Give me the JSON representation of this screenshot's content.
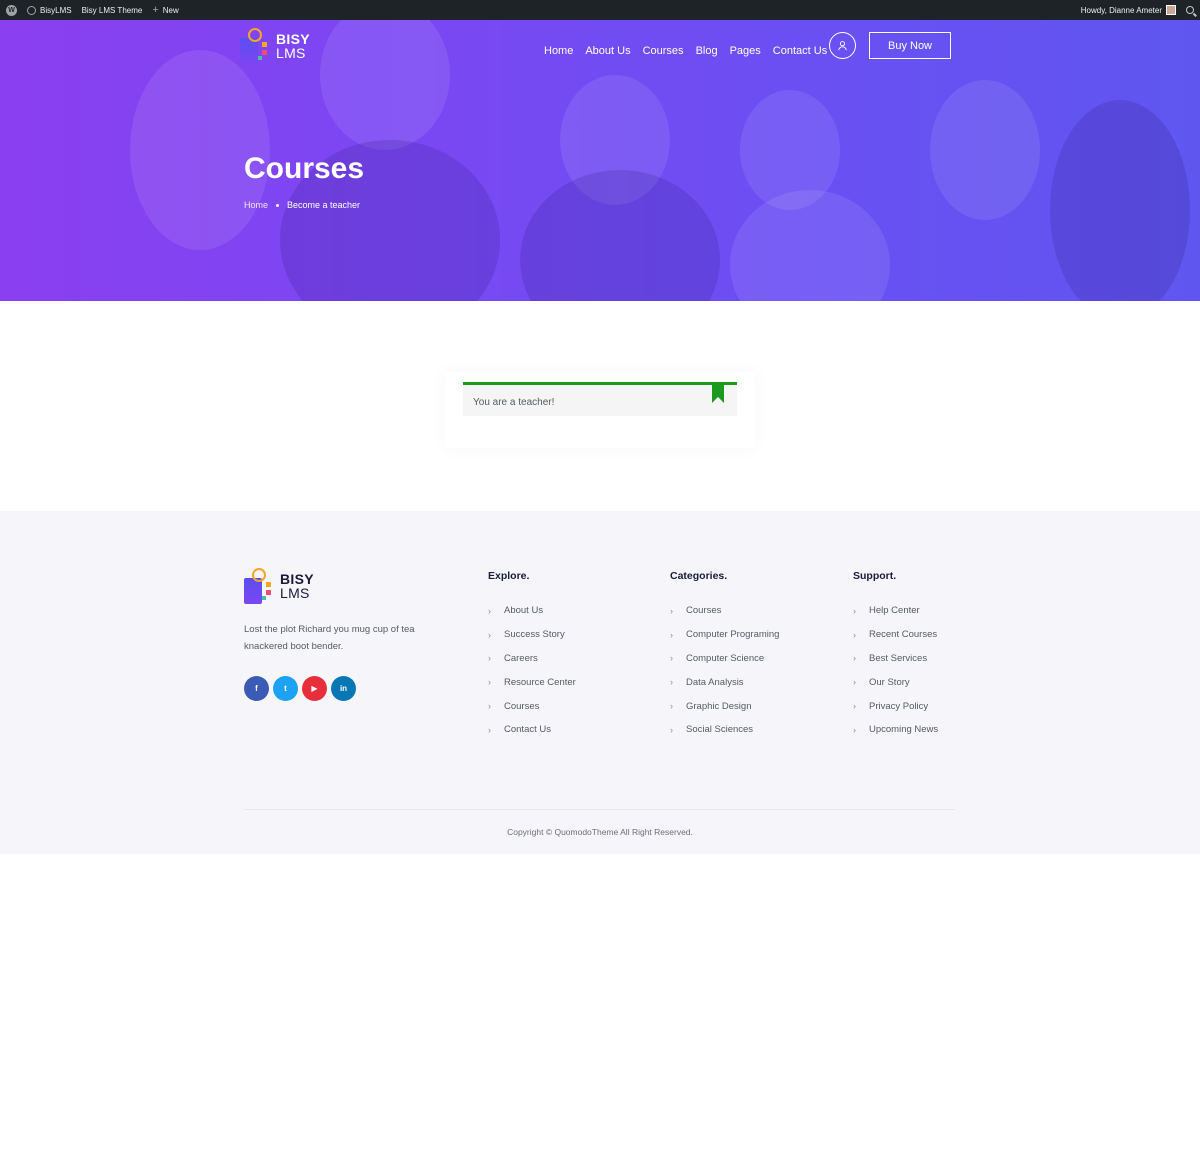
{
  "adminbar": {
    "site_name": "BisyLMS",
    "theme_name": "Bisy LMS Theme",
    "new_label": "New",
    "howdy": "Howdy, Dianne Ameter"
  },
  "brand": {
    "bold": "BISY",
    "light": "LMS"
  },
  "nav": {
    "items": [
      "Home",
      "About Us",
      "Courses",
      "Blog",
      "Pages",
      "Contact Us"
    ],
    "buy_label": "Buy Now"
  },
  "hero": {
    "title": "Courses",
    "breadcrumb_home": "Home",
    "breadcrumb_current": "Become a teacher"
  },
  "notice": {
    "message": "You are a teacher!"
  },
  "footer": {
    "description": "Lost the plot Richard you mug cup of tea knackered boot bender.",
    "socials": [
      {
        "icon": "facebook-icon",
        "glyph": "f",
        "color": "#3b5bb5"
      },
      {
        "icon": "twitter-icon",
        "glyph": "t",
        "color": "#1da1f2"
      },
      {
        "icon": "youtube-icon",
        "glyph": "▶",
        "color": "#e62f3b"
      },
      {
        "icon": "linkedin-icon",
        "glyph": "in",
        "color": "#0a77b5"
      }
    ],
    "columns": [
      {
        "title": "Explore.",
        "items": [
          "About Us",
          "Success Story",
          "Careers",
          "Resource Center",
          "Courses",
          "Contact Us"
        ]
      },
      {
        "title": "Categories.",
        "items": [
          "Courses",
          "Computer Programing",
          "Computer Science",
          "Data Analysis",
          "Graphic Design",
          "Social Sciences"
        ]
      },
      {
        "title": "Support.",
        "items": [
          "Help Center",
          "Recent Courses",
          "Best Services",
          "Our Story",
          "Privacy Policy",
          "Upcoming News"
        ]
      }
    ],
    "copyright": "Copyright © QuomodoTheme All Right Reserved."
  },
  "colors": {
    "accent": "#7a48f3",
    "success": "#1c9a1f",
    "footer_bg": "#f6f6fa"
  }
}
